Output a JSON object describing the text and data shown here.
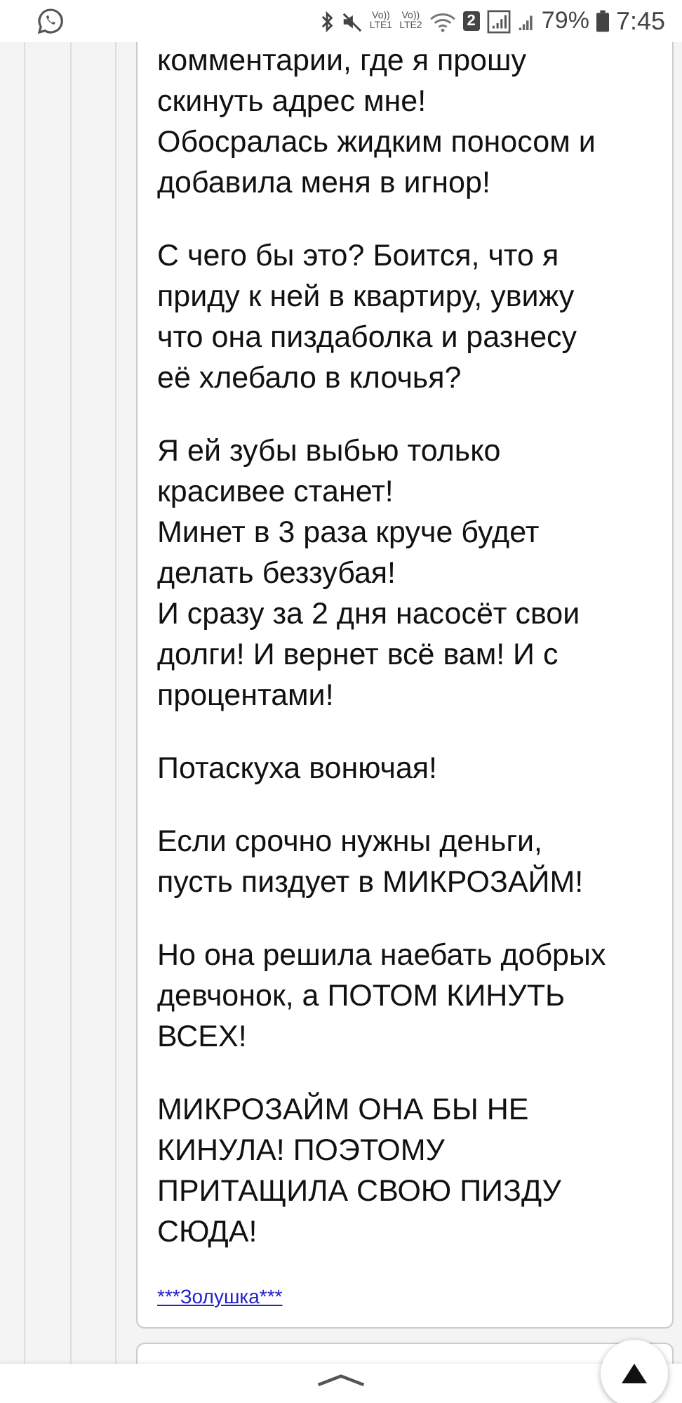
{
  "status_bar": {
    "volte": [
      {
        "top": "Vo))",
        "bottom": "LTE1"
      },
      {
        "top": "Vo))",
        "bottom": "LTE2"
      }
    ],
    "sim_badge": "2",
    "battery": "79%",
    "time": "7:45"
  },
  "post": {
    "paragraphs": [
      "комментарии, где я прошу\nскинуть адрес мне!\nОбосралась жидким поносом и\nдобавила меня в игнор!",
      "С чего бы это? Боится, что я\nприду к ней в квартиру, увижу\nчто она пиздаболка и разнесу\nеё хлебало в клочья?",
      "Я ей зубы выбью только\nкрасивее станет!\nМинет в 3 раза круче будет\nделать беззубая!\nИ сразу за 2 дня насосёт свои\nдолги! И вернет всё вам! И с\nпроцентами!",
      "Потаскуха вонючая!",
      "Если срочно нужны деньги,\nпусть пиздует в МИКРОЗАЙМ!",
      "Но она решила наебать добрых\nдевчонок, а ПОТОМ КИНУТЬ\nВСЕХ!",
      "МИКРОЗАЙМ ОНА БЫ НЕ\nКИНУЛА! ПОЭТОМУ\nПРИТАЩИЛА СВОЮ ПИЗДУ\nСЮДА!"
    ],
    "author": "***Золушка***"
  }
}
